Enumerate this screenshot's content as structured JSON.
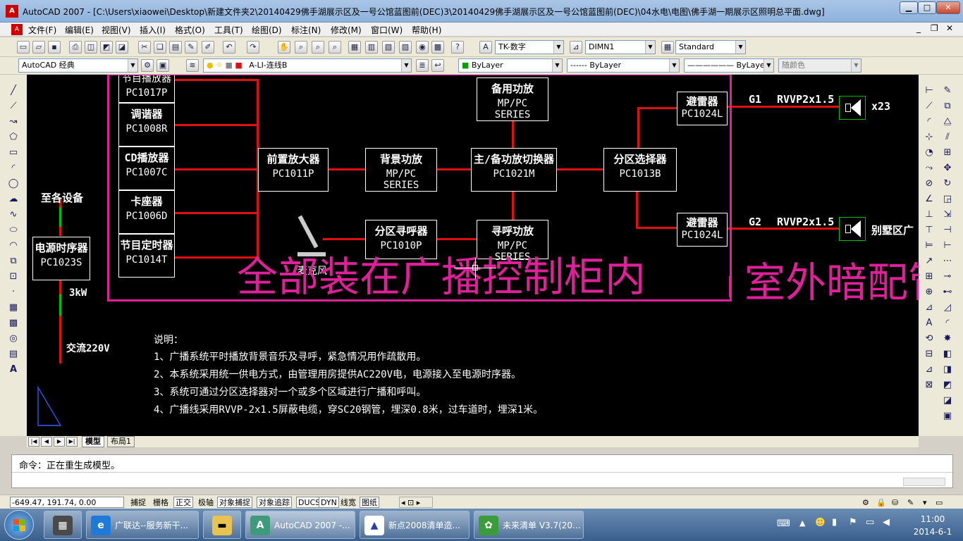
{
  "window": {
    "title": "AutoCAD 2007 - [C:\\Users\\xiaowei\\Desktop\\新建文件夹2\\20140429佛手湖展示区及一号公馆蓝图前(DEC)3\\20140429佛手湖展示区及一号公馆蓝图前(DEC)\\04水电\\电图\\佛手湖一期展示区照明总平面.dwg]",
    "app_icon": "A",
    "controls": {
      "minimize": "▁",
      "maximize": "□",
      "close": "✕"
    },
    "doc_controls": {
      "minimize": "_",
      "restore": "❐",
      "close": "✕"
    }
  },
  "menu": [
    "文件(F)",
    "编辑(E)",
    "视图(V)",
    "插入(I)",
    "格式(O)",
    "工具(T)",
    "绘图(D)",
    "标注(N)",
    "修改(M)",
    "窗口(W)",
    "帮助(H)"
  ],
  "toolbar1": {
    "text_style": "TK-数字",
    "dim_style": "DIMN1",
    "table_style": "Standard",
    "icons": [
      "new-icon",
      "open-icon",
      "save-icon",
      "print-icon",
      "preview-icon",
      "publish-icon",
      "plot-icon",
      "cut-icon",
      "copy-icon",
      "paste-icon",
      "match-icon",
      "brush-icon",
      "undo-icon",
      "redo-icon",
      "pan-icon",
      "zoom-realtime-icon",
      "zoom-window-icon",
      "zoom-previous-icon",
      "properties-icon",
      "design-center-icon",
      "tool-palette-icon",
      "sheet-set-icon",
      "markup-icon",
      "calculator-icon",
      "help-icon"
    ]
  },
  "toolbar2": {
    "workspace": "AutoCAD 经典",
    "layer": "A-LI-连线B",
    "color": "ByLayer",
    "linetype": "ByLayer",
    "lineweight": "ByLayer",
    "plotstyle": "随颜色",
    "linetype_preview": "------",
    "lineweight_preview": "——————"
  },
  "canvas": {
    "sources": [
      {
        "name": "节目播放器",
        "model": "PC1017P"
      },
      {
        "name": "调谐器",
        "model": "PC1008R"
      },
      {
        "name": "CD播放器",
        "model": "PC1007C"
      },
      {
        "name": "卡座器",
        "model": "PC1006D"
      },
      {
        "name": "节目定时器",
        "model": "PC1014T"
      }
    ],
    "preamp": {
      "name": "前置放大器",
      "model": "PC1011P"
    },
    "bg_amp": {
      "name": "背景功放",
      "model": "MP/PC SERIES"
    },
    "standby_amp": {
      "name": "备用功放",
      "model": "MP/PC SERIES"
    },
    "switcher": {
      "name": "主/备功放切换器",
      "model": "PC1021M"
    },
    "zone_selector": {
      "name": "分区选择器",
      "model": "PC1013B"
    },
    "zone_pager": {
      "name": "分区寻呼器",
      "model": "PC1010P"
    },
    "paging_amp": {
      "name": "寻呼功放",
      "model": "MP/PC SERIES"
    },
    "arrester1": {
      "name": "避雷器",
      "model": "PC1024L"
    },
    "arrester2": {
      "name": "避雷器",
      "model": "PC1024L"
    },
    "power_seq": {
      "name": "电源时序器",
      "model": "PC1023S"
    },
    "to_devices": "至各设备",
    "power_rating": "3kW",
    "ac_input": "交流220V",
    "mic_label": "麦克风",
    "g1": "G1",
    "g2": "G2",
    "cable1": "RVVP2x1.5",
    "cable2": "RVVP2x1.5",
    "spk1_count": "x23",
    "spk2_label": "别墅区广",
    "magenta_note": "全部装在广播控制柜内",
    "magenta_note2": "室外暗配管",
    "notes_title": "说明：",
    "notes": [
      "1、广播系统平时播放背景音乐及寻呼，紧急情况用作疏散用。",
      "2、本系统采用统一供电方式，由管理用房提供AC220V电，电源接入至电源时序器。",
      "3、系统可通过分区选择器对一个或多个区域进行广播和呼叫。",
      "4、广播线采用RVVP-2x1.5屏蔽电缆，穿SC20钢管，埋深0.8米，过车道时，埋深1米。"
    ],
    "colors": {
      "red": "#e01010",
      "magenta": "#e0209a",
      "green": "#00c000",
      "white": "#ffffff",
      "bg": "#000000"
    }
  },
  "tabs": {
    "model": "模型",
    "layout": "布局1",
    "nav": [
      "|◀",
      "◀",
      "▶",
      "▶|"
    ]
  },
  "command": {
    "line1": "命令：正在重生成模型。",
    "line2": ""
  },
  "status": {
    "coords": "-649.47, 191.74, 0.00",
    "buttons": [
      "捕捉",
      "栅格",
      "正交",
      "极轴",
      "对象捕捉",
      "对象追踪",
      "DUCS",
      "DYN",
      "线宽",
      "图纸"
    ],
    "active": [
      "正交",
      "对象捕捉",
      "对象追踪",
      "DUCS",
      "DYN",
      "图纸"
    ]
  },
  "taskbar": {
    "tasks": [
      {
        "label": "广联达--服务新干...",
        "color": "#1e7ad6",
        "icon": "e"
      },
      {
        "label": "AutoCAD 2007 -...",
        "color": "#3d9a7a",
        "icon": "A"
      },
      {
        "label": "新点2008清单造...",
        "color": "#2a3fa8",
        "icon": "▲"
      },
      {
        "label": "未来清单 V3.7(20...",
        "color": "#3a9c3a",
        "icon": "✿"
      }
    ],
    "time": "11:00",
    "date": "2014-6-1"
  }
}
